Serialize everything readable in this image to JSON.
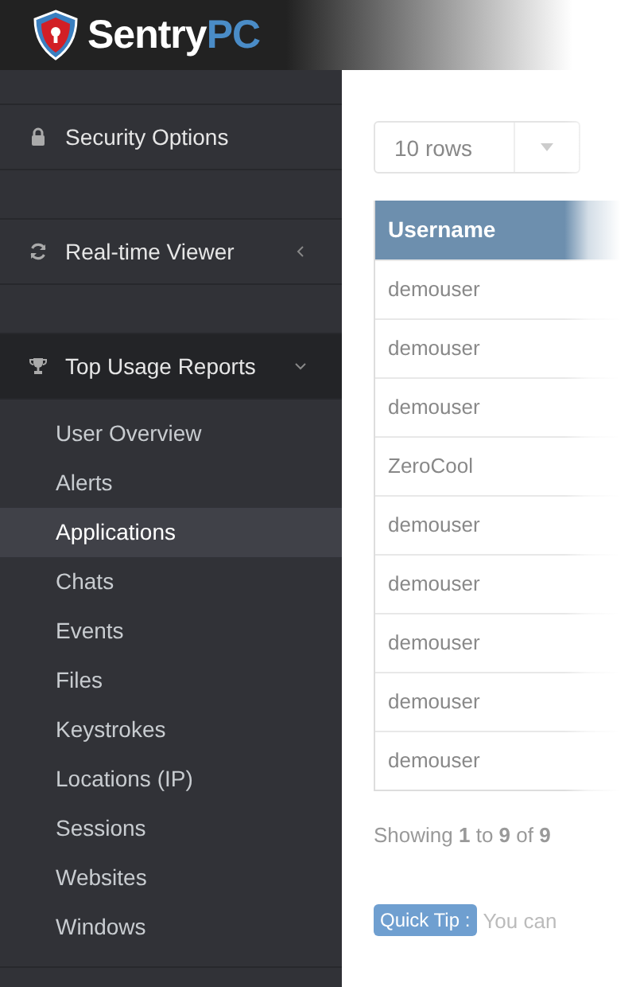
{
  "header": {
    "logo_main": "Sentry",
    "logo_accent": "PC"
  },
  "sidebar": {
    "items": [
      {
        "label": "Security Options",
        "kind": "item",
        "expanded": false
      },
      {
        "kind": "spacer"
      },
      {
        "label": "Real-time Viewer",
        "kind": "group",
        "expanded": false
      },
      {
        "kind": "spacer"
      },
      {
        "label": "Top Usage Reports",
        "kind": "group",
        "expanded": true,
        "children": [
          {
            "label": "User Overview",
            "selected": false
          },
          {
            "label": "Alerts",
            "selected": false
          },
          {
            "label": "Applications",
            "selected": true
          },
          {
            "label": "Chats",
            "selected": false
          },
          {
            "label": "Events",
            "selected": false
          },
          {
            "label": "Files",
            "selected": false
          },
          {
            "label": "Keystrokes",
            "selected": false
          },
          {
            "label": "Locations (IP)",
            "selected": false
          },
          {
            "label": "Sessions",
            "selected": false
          },
          {
            "label": "Websites",
            "selected": false
          },
          {
            "label": "Windows",
            "selected": false
          }
        ]
      }
    ]
  },
  "rows_select": {
    "value": "10 rows"
  },
  "table": {
    "columns": [
      "Username"
    ],
    "rows": [
      [
        "demouser"
      ],
      [
        "demouser"
      ],
      [
        "demouser"
      ],
      [
        "ZeroCool"
      ],
      [
        "demouser"
      ],
      [
        "demouser"
      ],
      [
        "demouser"
      ],
      [
        "demouser"
      ],
      [
        "demouser"
      ]
    ]
  },
  "info": "Showing **1** to **9** of **9**",
  "quick_tip": {
    "label": "Quick Tip :",
    "text": "You can"
  }
}
